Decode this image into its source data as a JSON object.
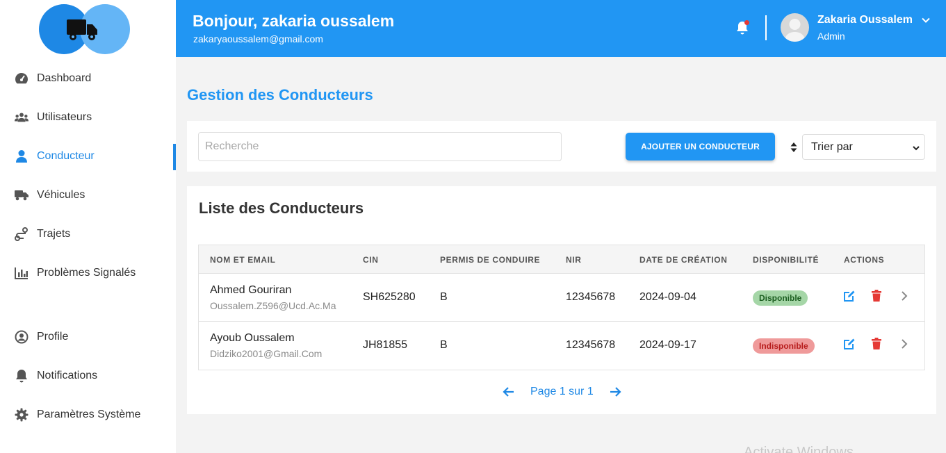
{
  "sidebar": {
    "logo": "truck-logo",
    "items": [
      {
        "label": "Dashboard",
        "icon": "gauge-icon"
      },
      {
        "label": "Utilisateurs",
        "icon": "users-icon"
      },
      {
        "label": "Conducteur",
        "icon": "user-icon",
        "active": true
      },
      {
        "label": "Véhicules",
        "icon": "truck-icon"
      },
      {
        "label": "Trajets",
        "icon": "route-icon"
      },
      {
        "label": "Problèmes Signalés",
        "icon": "bar-chart-icon"
      },
      {
        "label": "Profile",
        "icon": "user-circle-icon"
      },
      {
        "label": "Notifications",
        "icon": "bell-icon"
      },
      {
        "label": "Paramètres Système",
        "icon": "gear-icon"
      }
    ]
  },
  "header": {
    "greeting": "Bonjour, zakaria oussalem",
    "email": "zakaryaoussalem@gmail.com",
    "user_name": "Zakaria Oussalem",
    "user_role": "Admin"
  },
  "main": {
    "title": "Gestion des Conducteurs",
    "search_placeholder": "Recherche",
    "add_button": "AJOUTER UN CONDUCTEUR",
    "sort_label": "Trier par",
    "list_title": "Liste des Conducteurs",
    "columns": [
      "NOM ET EMAIL",
      "CIN",
      "PERMIS DE CONDUIRE",
      "NIR",
      "DATE DE CRÉATION",
      "DISPONIBILITÉ",
      "ACTIONS"
    ],
    "rows": [
      {
        "name": "Ahmed Gouriran",
        "email": "Oussalem.Z596@Ucd.Ac.Ma",
        "cin": "SH625280",
        "permis": "B",
        "nir": "12345678",
        "date": "2024-09-04",
        "status": "Disponible"
      },
      {
        "name": "Ayoub Oussalem",
        "email": "Didziko2001@Gmail.Com",
        "cin": "JH81855",
        "permis": "B",
        "nir": "12345678",
        "date": "2024-09-17",
        "status": "Indisponible"
      }
    ],
    "pagination": "Page 1 sur 1"
  },
  "watermark": "Activate Windows",
  "colors": {
    "primary": "#2196f3",
    "available": "#a5d6a7",
    "unavailable": "#ef9a9a",
    "delete": "#e53935"
  }
}
